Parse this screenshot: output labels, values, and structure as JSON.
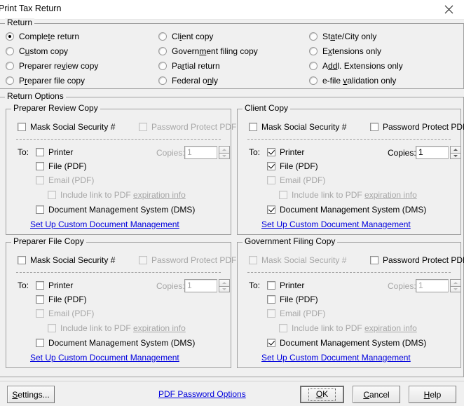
{
  "window": {
    "title": "Print Tax Return",
    "close_icon": "close-icon"
  },
  "return_group": {
    "legend": "Return",
    "selected": "Complete return",
    "options": [
      {
        "label": "Complete return",
        "acc": "t",
        "checked": true
      },
      {
        "label": "Custom copy",
        "acc": "u",
        "checked": false
      },
      {
        "label": "Preparer review copy",
        "acc": "v",
        "checked": false
      },
      {
        "label": "Preparer file copy",
        "acc": "r",
        "checked": false
      },
      {
        "label": "Client copy",
        "acc": "i",
        "checked": false
      },
      {
        "label": "Government filing copy",
        "acc": "m",
        "checked": false
      },
      {
        "label": "Partial return",
        "acc": "r",
        "checked": false
      },
      {
        "label": "Federal only",
        "acc": "n",
        "checked": false
      },
      {
        "label": "State/City only",
        "acc": "a",
        "checked": false
      },
      {
        "label": "Extensions only",
        "acc": "x",
        "checked": false
      },
      {
        "label": "Addl. Extensions only",
        "acc": "dd",
        "checked": false
      },
      {
        "label": "e-file validation only",
        "acc": "v",
        "checked": false
      }
    ]
  },
  "return_options": {
    "legend": "Return Options",
    "shared": {
      "mask_ssn": "Mask Social Security #",
      "password_protect": "Password Protect PDF",
      "to": "To:",
      "printer": "Printer",
      "file_pdf": "File (PDF)",
      "email_pdf": "Email (PDF)",
      "include_link": "Include link to PDF",
      "expiration_info": "expiration info",
      "dms": "Document Management System (DMS)",
      "setup_link": "Set Up Custom Document Management",
      "copies_label": "Copies:",
      "copies_value": "1"
    },
    "panels": [
      {
        "legend": "Preparer Review Copy",
        "mask_ssn": {
          "checked": false,
          "disabled": false
        },
        "password_protect": {
          "checked": false,
          "disabled": true
        },
        "printer": {
          "checked": false,
          "disabled": false
        },
        "file_pdf": {
          "checked": false,
          "disabled": false
        },
        "email_pdf": {
          "checked": false,
          "disabled": true
        },
        "include_link": {
          "checked": false,
          "disabled": true
        },
        "dms": {
          "checked": false,
          "disabled": false
        },
        "copies": {
          "value": "1",
          "disabled": true
        }
      },
      {
        "legend": "Client Copy",
        "mask_ssn": {
          "checked": false,
          "disabled": false
        },
        "password_protect": {
          "checked": false,
          "disabled": false
        },
        "printer": {
          "checked": true,
          "disabled": false
        },
        "file_pdf": {
          "checked": true,
          "disabled": false
        },
        "email_pdf": {
          "checked": false,
          "disabled": true
        },
        "include_link": {
          "checked": false,
          "disabled": true
        },
        "dms": {
          "checked": true,
          "disabled": false
        },
        "copies": {
          "value": "1",
          "disabled": false
        }
      },
      {
        "legend": "Preparer File Copy",
        "mask_ssn": {
          "checked": false,
          "disabled": false
        },
        "password_protect": {
          "checked": false,
          "disabled": true
        },
        "printer": {
          "checked": false,
          "disabled": false
        },
        "file_pdf": {
          "checked": false,
          "disabled": false
        },
        "email_pdf": {
          "checked": false,
          "disabled": true
        },
        "include_link": {
          "checked": false,
          "disabled": true
        },
        "dms": {
          "checked": false,
          "disabled": false
        },
        "copies": {
          "value": "1",
          "disabled": true
        }
      },
      {
        "legend": "Government Filing Copy",
        "mask_ssn": {
          "checked": false,
          "disabled": true
        },
        "password_protect": {
          "checked": false,
          "disabled": false
        },
        "printer": {
          "checked": false,
          "disabled": false
        },
        "file_pdf": {
          "checked": false,
          "disabled": false
        },
        "email_pdf": {
          "checked": false,
          "disabled": true
        },
        "include_link": {
          "checked": false,
          "disabled": true
        },
        "dms": {
          "checked": true,
          "disabled": false
        },
        "copies": {
          "value": "1",
          "disabled": true
        }
      }
    ]
  },
  "footer": {
    "settings": "Settings...",
    "pdf_password_options": "PDF Password Options",
    "ok": "OK",
    "cancel": "Cancel",
    "help": "Help"
  },
  "colors": {
    "dialog_bg": "#f0f0f0",
    "link": "#0000dd",
    "border": "#a0a0a0",
    "disabled_text": "#a6a6a6"
  }
}
